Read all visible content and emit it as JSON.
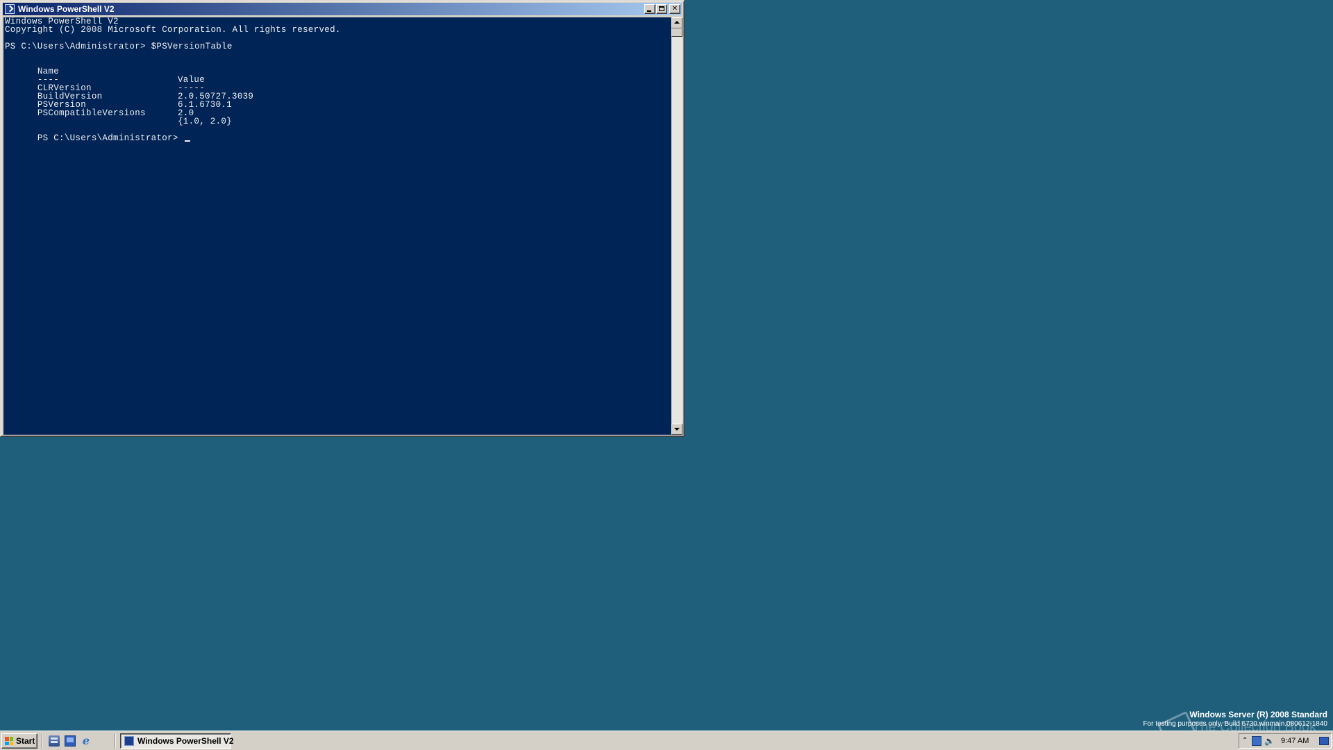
{
  "window": {
    "title": "Windows PowerShell V2"
  },
  "console": {
    "lines": [
      "Windows PowerShell V2",
      "Copyright (C) 2008 Microsoft Corporation. All rights reserved.",
      "",
      "PS C:\\Users\\Administrator> $PSVersionTable",
      ""
    ],
    "table": {
      "headers": [
        "Name",
        "Value"
      ],
      "underlines": [
        "----",
        "-----"
      ],
      "rows": [
        [
          "CLRVersion",
          "2.0.50727.3039"
        ],
        [
          "BuildVersion",
          "6.1.6730.1"
        ],
        [
          "PSVersion",
          "2.0"
        ],
        [
          "PSCompatibleVersions",
          "{1.0, 2.0}"
        ]
      ]
    },
    "prompt": "PS C:\\Users\\Administrator> ",
    "colors": {
      "background": "#012456",
      "foreground": "#eeedf0"
    }
  },
  "desktop": {
    "background": "#1f5f7c",
    "watermark": {
      "line1": "Windows Server (R) 2008 Standard",
      "line2": "For testing purposes only. Build 6730.winmain.080612-1840",
      "overlay": "The Collection Book"
    }
  },
  "taskbar": {
    "start_label": "Start",
    "quick_launch": [
      "server-manager-icon",
      "show-desktop-icon",
      "internet-explorer-icon"
    ],
    "tasks": [
      {
        "label": "Windows PowerShell V2",
        "active": true
      }
    ],
    "tray": {
      "icons": [
        "network-icon",
        "volume-icon"
      ],
      "time": "9:47 AM"
    }
  }
}
